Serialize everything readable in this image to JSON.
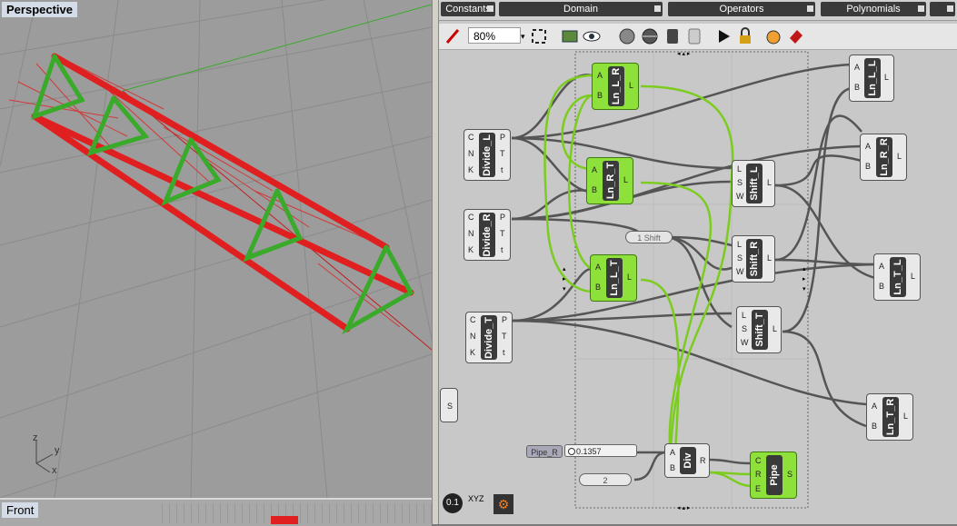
{
  "viewport": {
    "title": "Perspective",
    "bottom_label": "Front"
  },
  "axes": {
    "z": "z",
    "y": "y",
    "x": "x"
  },
  "tabs": {
    "constants": "Constants",
    "domain": "Domain",
    "operators": "Operators",
    "polynomials": "Polynomials"
  },
  "toolbar": {
    "zoom": "80%"
  },
  "nodes": {
    "ln_l_r": "Ln_L_R",
    "ln_r_t": "Ln_R_T",
    "ln_l_t": "Ln_L_T",
    "divide_l": "Divide_L",
    "divide_r": "Divide_R",
    "divide_t": "Divide_T",
    "ln_l_l": "Ln_L_L",
    "ln_r_r": "Ln_R_R",
    "ln_t_l": "Ln_T_L",
    "ln_t_r": "Ln_T_R",
    "shift_l": "Shift_L",
    "shift_r": "Shift_R",
    "shift_t": "Shift_T",
    "div": "Div",
    "pipe": "Pipe"
  },
  "ports": {
    "A": "A",
    "B": "B",
    "L": "L",
    "C": "C",
    "N": "N",
    "K": "K",
    "P": "P",
    "T": "T",
    "t": "t",
    "S": "S",
    "W": "W",
    "R": "R",
    "E": "E"
  },
  "sliders": {
    "shift": "1 Shift",
    "pipe_r_label": "Pipe_R",
    "pipe_r_value": "0.1357",
    "div_value": "2"
  },
  "bottom": {
    "version": "0.1",
    "xyz": "XYZ"
  },
  "colors": {
    "truss_red": "#e02020",
    "truss_green": "#3aaa2a",
    "wire_green": "#7ccc20",
    "wire_grey": "#555555",
    "selected": "#8ee03a"
  }
}
